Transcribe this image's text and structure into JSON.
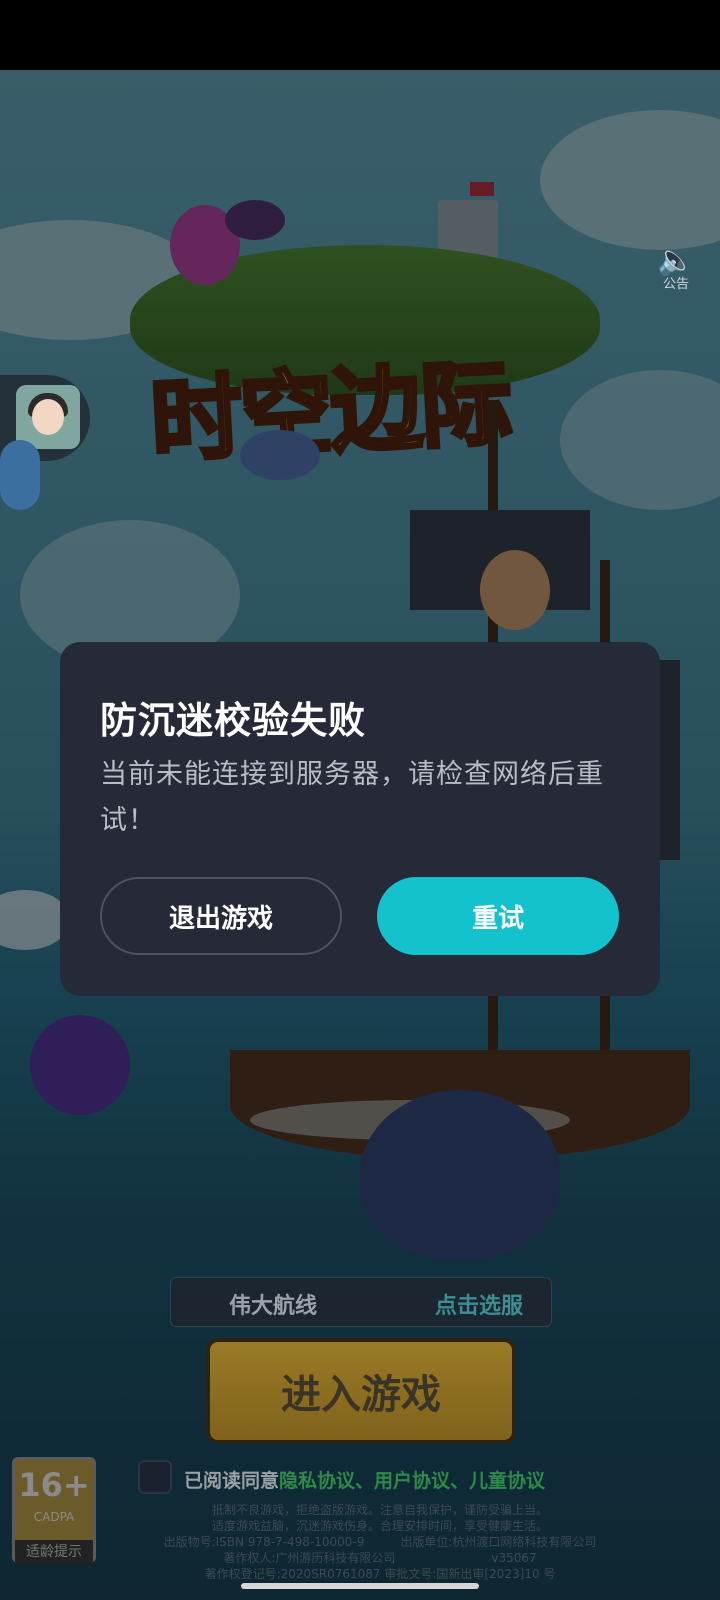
{
  "sound": {
    "label": "公告"
  },
  "dialog": {
    "title": "防沉迷校验失败",
    "message": "当前未能连接到服务器，请检查网络后重试！",
    "exit_label": "退出游戏",
    "retry_label": "重试",
    "retry_color": "#13c2cc"
  },
  "logo": {
    "text": "时空边际"
  },
  "server": {
    "name": "伟大航线",
    "select_label": "点击选服"
  },
  "enter_button": {
    "label": "进入游戏"
  },
  "age_rating": {
    "number": "16+",
    "org": "CADPA",
    "tip": "适龄提示"
  },
  "agreement": {
    "prefix": "已阅读同意",
    "links": "隐私协议、用户协议、儿童协议"
  },
  "fine_print": [
    "抵制不良游戏，拒绝盗版游戏。注意自我保护，谨防受骗上当。",
    "适度游戏益脑，沉迷游戏伤身。合理安排时间，享受健康生活。",
    "出版物号:ISBN 978-7-498-10000-9　　　出版单位:杭州渡口网络科技有限公司",
    "著作权人:广州游历科技有限公司　　　　　　　　v35067",
    "著作权登记号:2020SR0761087 审批文号:国新出审[2023]10 号"
  ]
}
